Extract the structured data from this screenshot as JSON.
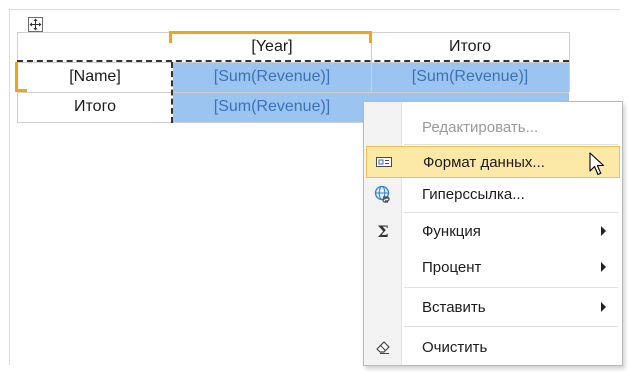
{
  "table": {
    "header": {
      "year": "[Year]",
      "total": "Итого"
    },
    "row1": {
      "name": "[Name]",
      "value": "[Sum(Revenue)]",
      "total_value": "[Sum(Revenue)]"
    },
    "row2": {
      "name": "Итого",
      "value": "[Sum(Revenue)]"
    }
  },
  "context_menu": {
    "items": [
      {
        "label": "Редактировать...",
        "icon": "",
        "enabled": false,
        "submenu": false
      },
      {
        "label": "Формат данных...",
        "icon": "format-data-icon",
        "enabled": true,
        "submenu": false,
        "highlighted": true
      },
      {
        "label": "Гиперссылка...",
        "icon": "hyperlink-globe-icon",
        "enabled": true,
        "submenu": false
      },
      {
        "label": "Функция",
        "icon": "sigma-icon",
        "enabled": true,
        "submenu": true
      },
      {
        "label": "Процент",
        "icon": "",
        "enabled": true,
        "submenu": true
      },
      {
        "label": "Вставить",
        "icon": "",
        "enabled": true,
        "submenu": true
      },
      {
        "label": "Очистить",
        "icon": "eraser-icon",
        "enabled": true,
        "submenu": false
      }
    ]
  },
  "colors": {
    "selection": "#9cc4f0",
    "selection_border": "#f3a21b",
    "menu_highlight": "#fde9a7"
  }
}
